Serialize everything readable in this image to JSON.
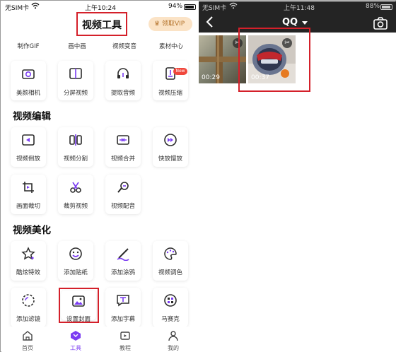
{
  "left": {
    "status": {
      "carrier": "无SIM卡",
      "time": "上午10:24",
      "battery": "94%"
    },
    "header": {
      "title": "视频工具",
      "vip_label": "领取VIP"
    },
    "rows_top": [
      {
        "label": "制作GIF",
        "icon": "gif-icon"
      },
      {
        "label": "画中画",
        "icon": "picture-in-picture-icon"
      },
      {
        "label": "视频变音",
        "icon": "voice-change-icon"
      },
      {
        "label": "素材中心",
        "icon": "material-center-icon"
      }
    ],
    "rows_second": [
      {
        "label": "美颜相机",
        "icon": "beauty-camera-icon"
      },
      {
        "label": "分屏视频",
        "icon": "split-screen-icon"
      },
      {
        "label": "提取音频",
        "icon": "headphones-icon"
      },
      {
        "label": "视频压缩",
        "icon": "compress-icon",
        "badge": "New"
      }
    ],
    "section_edit": {
      "title": "视频编辑",
      "items": [
        {
          "label": "视频倒放",
          "icon": "reverse-icon"
        },
        {
          "label": "视频分割",
          "icon": "split-icon"
        },
        {
          "label": "视频合并",
          "icon": "merge-icon"
        },
        {
          "label": "快放慢放",
          "icon": "speed-icon"
        },
        {
          "label": "画面裁切",
          "icon": "crop-icon"
        },
        {
          "label": "裁剪视频",
          "icon": "trim-icon"
        },
        {
          "label": "视频配音",
          "icon": "dubbing-icon"
        }
      ]
    },
    "section_beauty": {
      "title": "视频美化",
      "items": [
        {
          "label": "酷炫特效",
          "icon": "effects-star-icon"
        },
        {
          "label": "添加贴纸",
          "icon": "sticker-icon"
        },
        {
          "label": "添加涂鸦",
          "icon": "brush-icon"
        },
        {
          "label": "视频调色",
          "icon": "palette-icon"
        },
        {
          "label": "添加滤镜",
          "icon": "filter-icon"
        },
        {
          "label": "设置封面",
          "icon": "cover-image-icon"
        },
        {
          "label": "添加字幕",
          "icon": "subtitle-icon"
        },
        {
          "label": "马赛克",
          "icon": "mosaic-icon"
        }
      ]
    },
    "tabbar": [
      {
        "label": "首页",
        "icon": "home-icon"
      },
      {
        "label": "工具",
        "icon": "tools-icon",
        "active": true
      },
      {
        "label": "教程",
        "icon": "tutorial-icon"
      },
      {
        "label": "我的",
        "icon": "profile-icon"
      }
    ],
    "accent_color": "#7b3cf2",
    "highlight_color": "#d4202a"
  },
  "right": {
    "status": {
      "carrier": "无SIM卡",
      "time": "上午11:48",
      "battery": "88%"
    },
    "album_title": "QQ",
    "videos": [
      {
        "duration": "00:29"
      },
      {
        "duration": "00:37"
      }
    ]
  }
}
